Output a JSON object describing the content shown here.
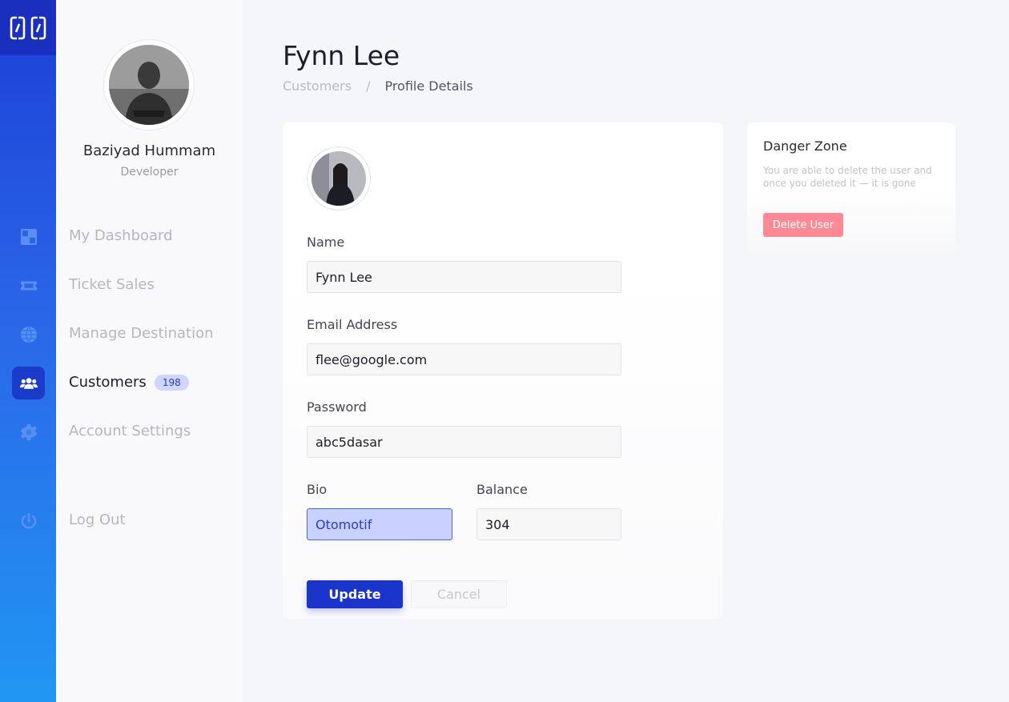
{
  "theme": {
    "accent": "#1b35cc",
    "rail_top": "#1c3fd6",
    "rail_bottom": "#2196f3",
    "danger": "#ff8a96",
    "badge_bg": "#cfd6ff"
  },
  "rail": {
    "logo_icon": "brand-logo-icon",
    "icons": [
      "dashboard-icon",
      "ticket-icon",
      "globe-icon",
      "users-icon",
      "gear-icon",
      "power-icon"
    ]
  },
  "sidebar": {
    "user": {
      "name": "Baziyad Hummam",
      "role": "Developer"
    },
    "items": [
      {
        "label": "My Dashboard"
      },
      {
        "label": "Ticket Sales"
      },
      {
        "label": "Manage Destination"
      },
      {
        "label": "Customers",
        "badge": "198"
      },
      {
        "label": "Account Settings"
      }
    ],
    "logout_label": "Log Out"
  },
  "header": {
    "title": "Fynn Lee",
    "breadcrumb": {
      "parent": "Customers",
      "separator": "/",
      "current": "Profile Details"
    }
  },
  "form": {
    "name_label": "Name",
    "name_value": "Fynn Lee",
    "email_label": "Email Address",
    "email_value": "flee@google.com",
    "password_label": "Password",
    "password_value": "abc5dasar",
    "bio_label": "Bio",
    "bio_value": "Otomotif",
    "balance_label": "Balance",
    "balance_value": "304",
    "update_label": "Update",
    "cancel_label": "Cancel"
  },
  "danger_zone": {
    "title": "Danger Zone",
    "description": "You are able to delete the user and once you deleted it — it is gone",
    "button_label": "Delete User"
  }
}
